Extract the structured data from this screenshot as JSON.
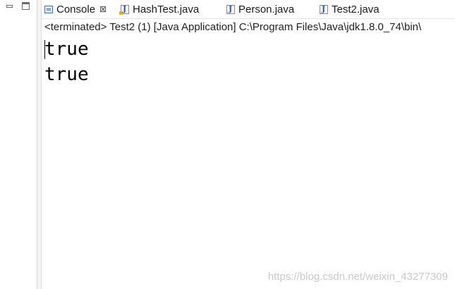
{
  "tabs": [
    {
      "label": "Console",
      "icon": "console-icon",
      "active": true,
      "close": "⊠"
    },
    {
      "label": "HashTest.java",
      "icon": "java-file-icon"
    },
    {
      "label": "Person.java",
      "icon": "java-file-icon"
    },
    {
      "label": "Test2.java",
      "icon": "java-file-icon"
    }
  ],
  "console": {
    "status": "<terminated> Test2 (1) [Java Application] C:\\Program Files\\Java\\jdk1.8.0_74\\bin\\",
    "output": [
      "true",
      "true"
    ]
  },
  "watermark": "https://blog.csdn.net/weixin_43277309"
}
